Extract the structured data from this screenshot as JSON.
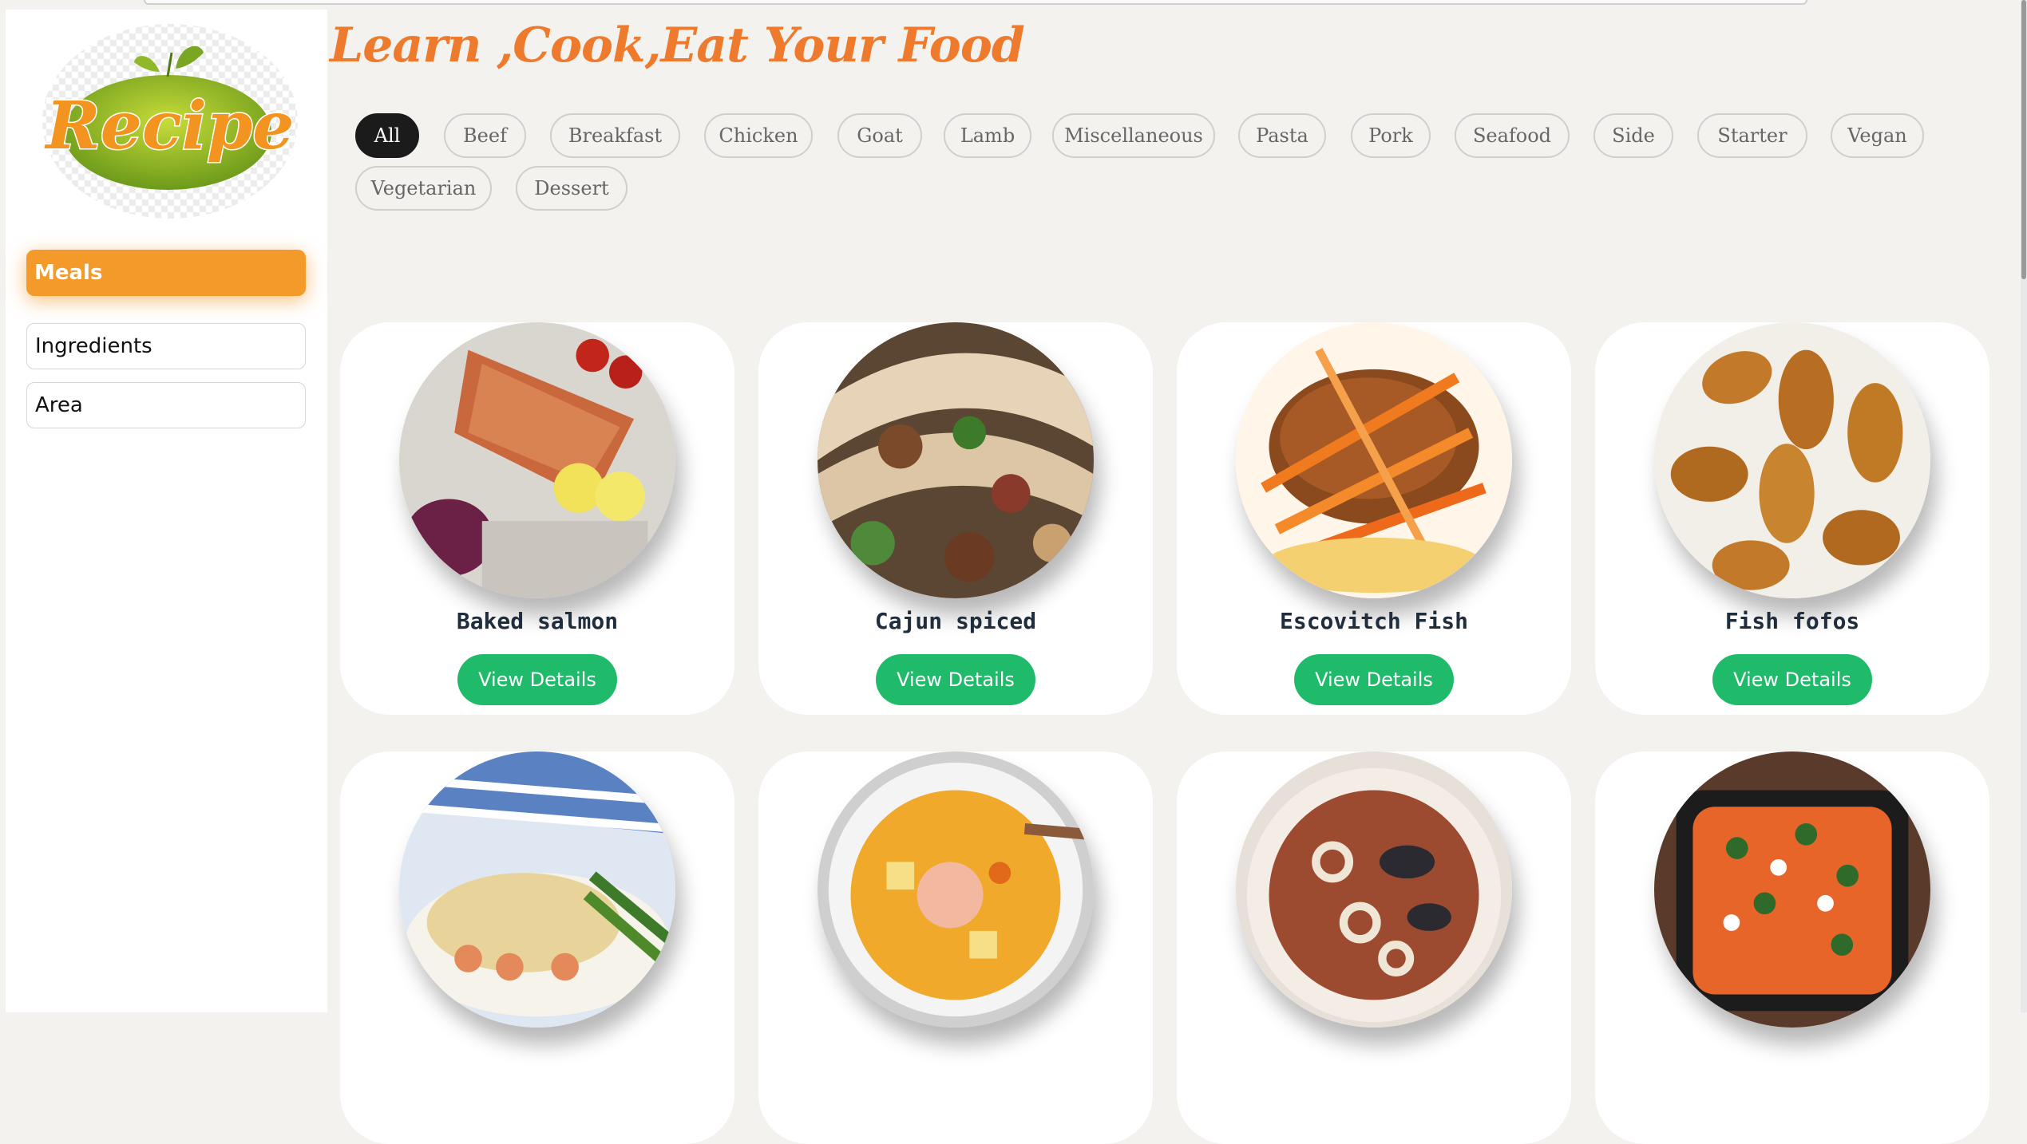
{
  "brand": {
    "logo_text": "Recipe"
  },
  "sidebar": {
    "items": [
      {
        "label": "Meals",
        "active": true
      },
      {
        "label": "Ingredients",
        "active": false
      },
      {
        "label": "Area",
        "active": false
      }
    ]
  },
  "main": {
    "title": "Learn ,Cook,Eat Your Food",
    "filters": [
      "All",
      "Beef",
      "Breakfast",
      "Chicken",
      "Goat",
      "Lamb",
      "Miscellaneous",
      "Pasta",
      "Pork",
      "Seafood",
      "Side",
      "Starter",
      "Vegan",
      "Vegetarian",
      "Dessert"
    ],
    "active_filter": "All",
    "view_details_label": "View Details",
    "meals": [
      {
        "name": "Baked salmon",
        "photo": "salmon-photo"
      },
      {
        "name": "Cajun spiced",
        "photo": "tacos-photo"
      },
      {
        "name": "Escovitch Fish",
        "photo": "escovitch-photo"
      },
      {
        "name": "Fish fofos",
        "photo": "fofos-photo"
      },
      {
        "name": "",
        "photo": "fish-pie-photo"
      },
      {
        "name": "",
        "photo": "chowder-photo"
      },
      {
        "name": "",
        "photo": "seafood-stew-photo"
      },
      {
        "name": "",
        "photo": "shakshuka-photo"
      }
    ]
  },
  "colors": {
    "accent": "#f39a2b",
    "title": "#ee7b2d",
    "button": "#1fbb6b",
    "chip_active": "#1b1b1b",
    "background": "#f3f2ef"
  }
}
